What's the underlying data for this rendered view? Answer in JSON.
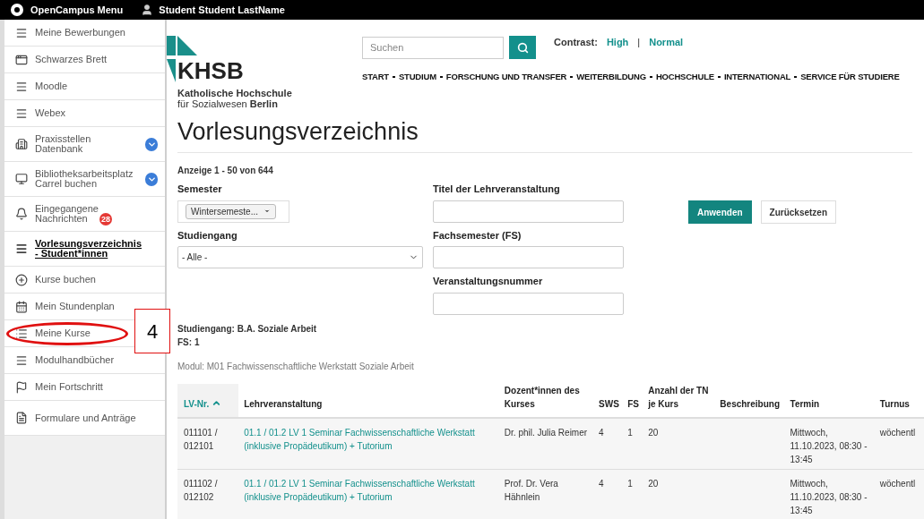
{
  "top_bar": {
    "menu_label": "OpenCampus Menu",
    "user_name": "Student Student LastName"
  },
  "sidebar": {
    "items": [
      {
        "label": "Meine Bewerbungen",
        "selected": false,
        "expandable": false,
        "circled": false
      },
      {
        "label": "Schwarzes Brett",
        "selected": false,
        "expandable": false,
        "circled": false
      },
      {
        "label": "Moodle",
        "selected": false,
        "expandable": false,
        "circled": false
      },
      {
        "label": "Webex",
        "selected": false,
        "expandable": false,
        "circled": false
      },
      {
        "label": "Praxisstellen Datenbank",
        "selected": false,
        "expandable": true,
        "circled": false
      },
      {
        "label": "Bibliotheksarbeitsplatz Carrel buchen",
        "selected": false,
        "expandable": true,
        "circled": false
      },
      {
        "label": "Eingegangene Nachrichten",
        "selected": false,
        "expandable": false,
        "circled": false,
        "badge": "28"
      },
      {
        "label": "Vorlesungsverzeichnis - Student*innen",
        "selected": true,
        "expandable": false,
        "circled": false
      },
      {
        "label": "Kurse buchen",
        "selected": false,
        "expandable": false,
        "circled": false
      },
      {
        "label": "Mein Stundenplan",
        "selected": false,
        "expandable": false,
        "circled": false
      },
      {
        "label": "Meine Kurse",
        "selected": false,
        "expandable": false,
        "circled": true
      },
      {
        "label": "Modulhandbücher",
        "selected": false,
        "expandable": false,
        "circled": false
      },
      {
        "label": "Mein Fortschritt",
        "selected": false,
        "expandable": false,
        "circled": false
      },
      {
        "label": "Formulare und Anträge",
        "selected": false,
        "expandable": false,
        "circled": false
      }
    ]
  },
  "annotation": {
    "label": "4"
  },
  "header": {
    "logo_text": "KHSB",
    "logo_subtitle_1": "Katholische Hochschule",
    "logo_subtitle_2": "für Sozialwesen **Berlin**",
    "search": {
      "placeholder": "Suchen"
    },
    "contrast_label": "Contrast:",
    "contrast_options": [
      "High",
      "Normal"
    ],
    "contrast_separator": "|",
    "nav": [
      "START",
      "STUDIUM",
      "FORSCHUNG UND TRANSFER",
      "WEITERBILDUNG",
      "HOCHSCHULE",
      "INTERNATIONAL",
      "SERVICE FÜR STUDIERE"
    ]
  },
  "page_title": "Vorlesungsverzeichnis",
  "result_count": "Anzeige 1 - 50 von 644",
  "filters": {
    "semester": {
      "label": "Semester",
      "value": "Wintersemeste..."
    },
    "studiengang": {
      "label": "Studiengang",
      "value": "- Alle -"
    },
    "titel": {
      "label": "Titel der Lehrveranstaltung"
    },
    "fachsemester": {
      "label": "Fachsemester (FS)"
    },
    "nummer": {
      "label": "Veranstaltungsnummer"
    },
    "apply_button": "Anwenden",
    "reset_button": "Zurücksetzen"
  },
  "summary": [
    "Studiengang: B.A. Soziale Arbeit",
    "FS: 1"
  ],
  "module_heading": "Modul: M01 Fachwissenschaftliche Werkstatt Soziale Arbeit",
  "table": {
    "columns": [
      {
        "label": "LV-Nr.",
        "sorted": true
      },
      {
        "label": "Lehrveranstaltung",
        "sorted": false
      },
      {
        "label": "Dozent*innen des Kurses",
        "sorted": false
      },
      {
        "label": "SWS",
        "sorted": false
      },
      {
        "label": "FS",
        "sorted": false
      },
      {
        "label": "Anzahl der TN je Kurs",
        "sorted": false
      },
      {
        "label": "Beschreibung",
        "sorted": false
      },
      {
        "label": "Termin",
        "sorted": false
      },
      {
        "label": "Turnus",
        "sorted": false
      }
    ],
    "rows": [
      {
        "lv_nr": "011101 / 012101",
        "title": "01.1 / 01.2 LV 1 Seminar Fachwissenschaftliche Werkstatt (inklusive Propädeutikum) + Tutorium",
        "lecturer": "Dr. phil. Julia Reimer",
        "sws": "4",
        "fs": "1",
        "participants": "20",
        "termin": "Mittwoch, 11.10.2023, 08:30 - 13:45",
        "turnus": "wöchentl"
      },
      {
        "lv_nr": "011102 / 012102",
        "title": "01.1 / 01.2 LV 1 Seminar Fachwissenschaftliche Werkstatt (inklusive Propädeutikum) + Tutorium",
        "lecturer": "Prof. Dr. Vera Hähnlein",
        "sws": "4",
        "fs": "1",
        "participants": "20",
        "termin": "Mittwoch, 11.10.2023, 08:30 - 13:45",
        "turnus": "wöchentl"
      }
    ]
  }
}
